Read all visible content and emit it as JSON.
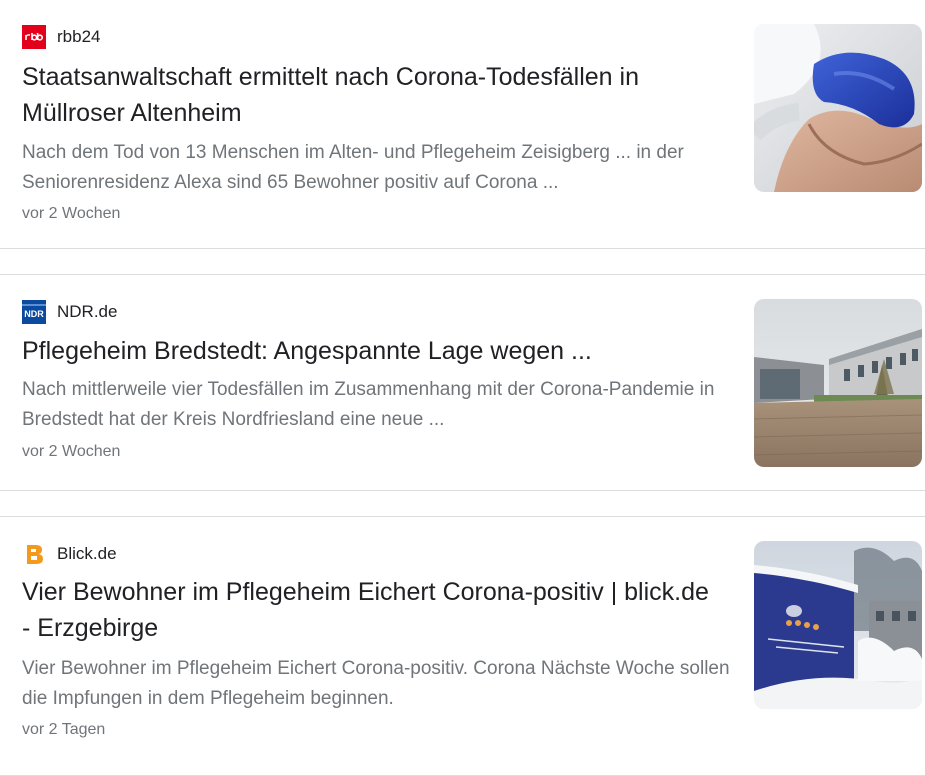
{
  "results": [
    {
      "source": "rbb24",
      "favicon": "rbb-logo-icon",
      "favicon_text": "rbb",
      "headline": "Staatsanwaltschaft ermittelt nach Corona-Todesfällen in Müllroser Altenheim",
      "snippet": "Nach dem Tod von 13 Menschen im Alten- und Pflegeheim Zeisigberg ... in der Seniorenresidenz Alexa sind 65 Bewohner positiv auf Corona ...",
      "age": "vor 2 Wochen",
      "thumbnail": "gloved-hand-image"
    },
    {
      "source": "NDR.de",
      "favicon": "ndr-logo-icon",
      "favicon_text": "NDR",
      "headline": "Pflegeheim Bredstedt: Angespannte Lage wegen ...",
      "snippet": "Nach mittlerweile vier Todesfällen im Zusammenhang mit der Corona-Pandemie in Bredstedt hat der Kreis Nordfriesland eine neue ...",
      "age": "vor 2 Wochen",
      "thumbnail": "care-home-building-image"
    },
    {
      "source": "Blick.de",
      "favicon": "blick-logo-icon",
      "favicon_text": "B",
      "headline": "Vier Bewohner im Pflegeheim Eichert Corona-positiv | blick.de - Erzgebirge",
      "snippet": "Vier Bewohner im Pflegeheim Eichert Corona-positiv. Corona Nächste Woche sollen die Impfungen in dem Pflegeheim beginnen.",
      "age": "vor 2 Tagen",
      "thumbnail": "snowy-care-home-sign-image"
    }
  ],
  "colors": {
    "title": "#202124",
    "snippet": "#70757a",
    "border": "#dadce0",
    "rbb_red": "#e2001a",
    "ndr_blue": "#0b4a9e",
    "blick_orange": "#f39a1e"
  }
}
